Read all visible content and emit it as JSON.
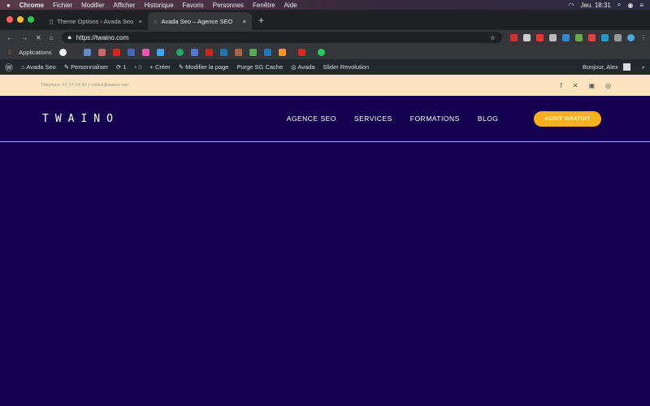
{
  "menubar": {
    "app": "Chrome",
    "items": [
      "Fichier",
      "Modifier",
      "Afficher",
      "Historique",
      "Favoris",
      "Personnes",
      "Fenêtre",
      "Aide"
    ],
    "clock": "Jeu. 18:31"
  },
  "tabs": [
    {
      "title": "Theme Options ‹ Avada Seo —"
    },
    {
      "title": "Avada Seo – Agence SEO"
    }
  ],
  "address": {
    "url": "https://twaino.com"
  },
  "bookmarks": {
    "apps": "Applications"
  },
  "wpbar": {
    "site": "Avada Seo",
    "customize": "Personnaliser",
    "updates": "1",
    "comments": "0",
    "new": "Créer",
    "edit": "Modifier la page",
    "purge": "Purge SG Cache",
    "avada": "Avada",
    "slider": "Slider Revolution",
    "greeting": "Bonjour, Alex"
  },
  "topbar": {
    "contact": "Téléphone: XX XX XX XX  |  contact@twaino.com"
  },
  "header": {
    "logo": "TWAINO",
    "nav": [
      "AGENCE SEO",
      "SERVICES",
      "FORMATIONS",
      "BLOG"
    ],
    "cta": "AUDIT GRATUIT"
  },
  "colors": {
    "navy": "#13004f",
    "cream": "#fde4c1",
    "cta": "#f8b020"
  }
}
